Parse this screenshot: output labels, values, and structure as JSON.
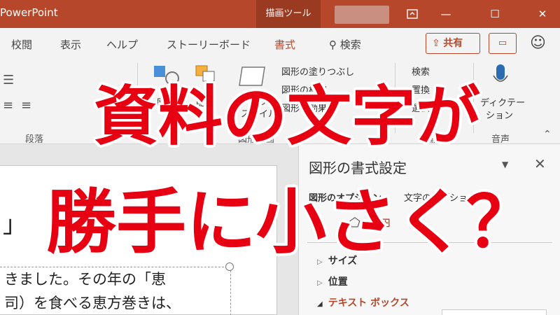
{
  "titlebar": {
    "app_name": "PowerPoint",
    "context_tab": "描画ツール",
    "ribbon_display_icon": "ribbon-display-icon",
    "minimize_glyph": "—",
    "maximize_glyph": "☐",
    "close_glyph": "✕"
  },
  "tabs": {
    "items": [
      "校閲",
      "表示",
      "ヘルプ",
      "ストーリーボード",
      "書式"
    ],
    "active": "書式",
    "search": "検索",
    "search_glyph": "⚲",
    "share": "共有",
    "share_glyph": "⇪",
    "comment_glyph": "▭",
    "smiley_glyph": "☺"
  },
  "ribbon": {
    "groups": {
      "paragraph": "段落",
      "drawing": "図形描画",
      "editing": "編集",
      "voice": "音声"
    },
    "shape_fill": "図形の塗りつぶし",
    "shape_outline": "図形の枠線",
    "shape_effects": "図形の効果",
    "shape": "図形",
    "arrange": "配置",
    "quick_styles": "クイック",
    "quick_styles_2": "スタイル",
    "find": "検索",
    "replace": "置換",
    "select": "選択",
    "dictate": "ディクテー",
    "dictate_2": "ション"
  },
  "slide": {
    "bracket": "」",
    "lines": [
      "きました。その年の「恵",
      "司）を食べる恵方巻きは、"
    ]
  },
  "pane": {
    "title": "図形の書式設定",
    "subtabs": [
      "図形のオプション",
      "文字のオプション"
    ],
    "sections": [
      "サイズ",
      "位置",
      "テキスト ボックス"
    ],
    "expanded_section": "テキスト ボックス",
    "close_glyph": "✕",
    "dropdown_glyph": "▼"
  },
  "caption": {
    "line1": "資料の文字が",
    "line2": "勝手に小さく？"
  },
  "colors": {
    "accent": "#b7472a",
    "caption_red": "#e60012"
  }
}
